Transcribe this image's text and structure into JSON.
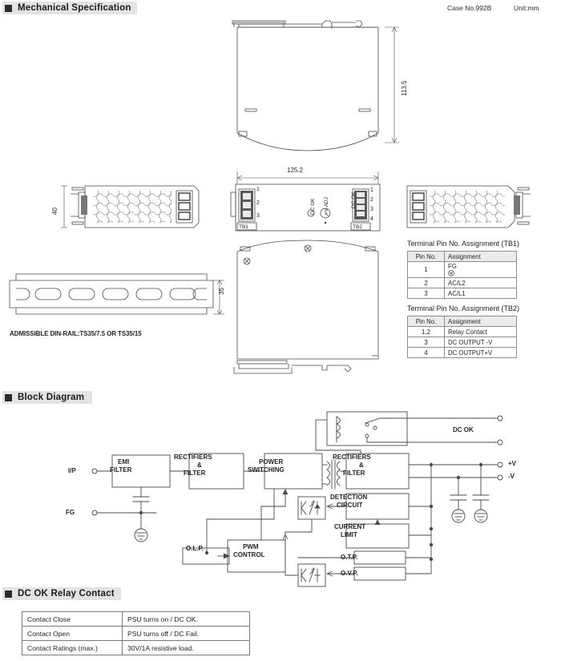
{
  "sections": {
    "mechanical": {
      "title": "Mechanical Specification",
      "bullet": "square-bullet"
    },
    "block": {
      "title": "Block Diagram",
      "bullet": "square-bullet"
    },
    "relay": {
      "title": "DC OK Relay Contact",
      "bullet": "square-bullet"
    }
  },
  "header_info": {
    "case": "Case No.992B",
    "unit": "Unit:mm"
  },
  "mechanical": {
    "dimensions": {
      "height_front": "113.5",
      "width_front": "125.2",
      "side_height": "40",
      "dinrail_height": "35"
    },
    "connectors": {
      "tb1_label": "TB1",
      "tb2_label": "TB2",
      "tb1_pins": [
        "1",
        "2",
        "3"
      ],
      "tb2_pins": [
        "1",
        "2",
        "3",
        "4"
      ]
    },
    "front_panel_marks": {
      "dc_ok_led": "DC OK",
      "v_adj": "+V ADJ",
      "dc_ok_text": "DC OK"
    },
    "dinrail_note": "ADMISSIBLE DIN-RAIL:TS35/7.5 OR TS35/15"
  },
  "tb1_table": {
    "caption": "Terminal Pin No.  Assignment (TB1)",
    "columns": [
      "Pin No.",
      "Assignment"
    ],
    "rows": [
      {
        "pin": "1",
        "assignment": "FG",
        "has_earth_symbol": true
      },
      {
        "pin": "2",
        "assignment": "AC/L2",
        "has_earth_symbol": false
      },
      {
        "pin": "3",
        "assignment": "AC/L1",
        "has_earth_symbol": false
      }
    ]
  },
  "tb2_table": {
    "caption": "Terminal Pin No.  Assignment (TB2)",
    "columns": [
      "Pin No.",
      "Assignment"
    ],
    "rows": [
      {
        "pin": "1,2",
        "assignment": "Relay Contact"
      },
      {
        "pin": "3",
        "assignment": "DC OUTPUT -V"
      },
      {
        "pin": "4",
        "assignment": "DC OUTPUT+V"
      }
    ]
  },
  "block_diagram": {
    "inputs": [
      {
        "id": "ip",
        "label": "I/P"
      },
      {
        "id": "fg",
        "label": "FG"
      }
    ],
    "blocks": [
      {
        "id": "emi",
        "lines": [
          "EMI",
          "FILTER"
        ]
      },
      {
        "id": "rect1",
        "lines": [
          "RECTIFIERS",
          "&",
          "FILTER"
        ]
      },
      {
        "id": "power",
        "lines": [
          "POWER",
          "SWITCHING"
        ]
      },
      {
        "id": "rect2",
        "lines": [
          "RECTIFIERS",
          "&",
          "FILTER"
        ]
      },
      {
        "id": "detect",
        "lines": [
          "DETECTION",
          "CIRCUIT"
        ]
      },
      {
        "id": "current",
        "lines": [
          "CURRENT",
          "LIMIT"
        ]
      },
      {
        "id": "otp",
        "lines": [
          "O.T.P."
        ]
      },
      {
        "id": "ovp",
        "lines": [
          "O.V.P."
        ]
      },
      {
        "id": "olp",
        "lines": [
          "O.L.P."
        ]
      },
      {
        "id": "pwm",
        "lines": [
          "PWM",
          "CONTROL"
        ]
      }
    ],
    "outputs": [
      {
        "id": "dcok",
        "label": "DC OK"
      },
      {
        "id": "vpos",
        "label": "+V"
      },
      {
        "id": "vneg",
        "label": "-V"
      }
    ]
  },
  "relay_table": {
    "rows": [
      {
        "condition": "Contact Close",
        "description": "PSU turns on / DC OK."
      },
      {
        "condition": "Contact Open",
        "description": "PSU turns off / DC Fail."
      },
      {
        "condition": "Contact Ratings (max.)",
        "description": "30V/1A resistive load."
      }
    ]
  },
  "colors": {
    "header_bg": "#e3e3e3",
    "line": "#4a4a4a",
    "text": "#231f20",
    "table_border": "#8d8d8d"
  }
}
